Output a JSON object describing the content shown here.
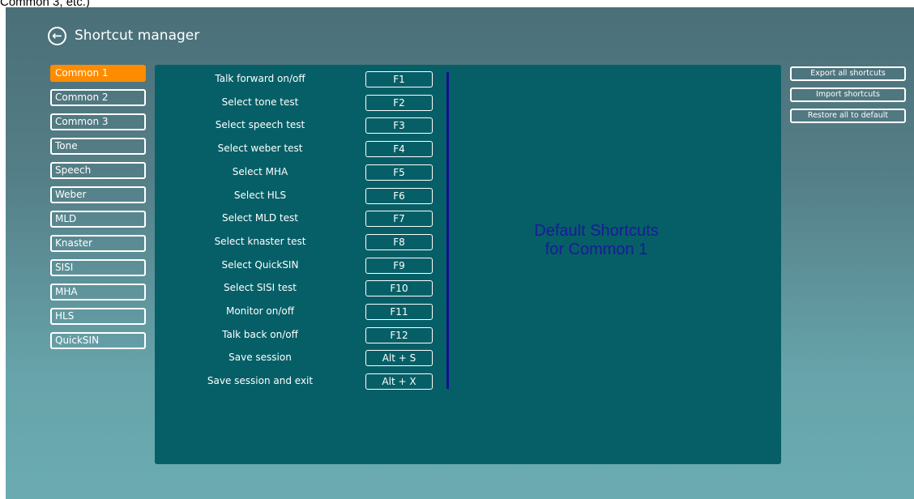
{
  "caption": "Common 3, etc.)",
  "header": {
    "back_icon": "arrow-left-circle-icon",
    "title": "Shortcut manager"
  },
  "tabs": [
    {
      "label": "Common 1",
      "active": true
    },
    {
      "label": "Common 2",
      "active": false
    },
    {
      "label": "Common 3",
      "active": false
    },
    {
      "label": "Tone",
      "active": false
    },
    {
      "label": "Speech",
      "active": false
    },
    {
      "label": "Weber",
      "active": false
    },
    {
      "label": "MLD",
      "active": false
    },
    {
      "label": "Knaster",
      "active": false
    },
    {
      "label": "SISI",
      "active": false
    },
    {
      "label": "MHA",
      "active": false
    },
    {
      "label": "HLS",
      "active": false
    },
    {
      "label": "QuickSIN",
      "active": false
    }
  ],
  "shortcuts": [
    {
      "action": "Talk forward on/off",
      "key": "F1"
    },
    {
      "action": "Select tone test",
      "key": "F2"
    },
    {
      "action": "Select speech test",
      "key": "F3"
    },
    {
      "action": "Select weber test",
      "key": "F4"
    },
    {
      "action": "Select MHA",
      "key": "F5"
    },
    {
      "action": "Select HLS",
      "key": "F6"
    },
    {
      "action": "Select MLD test",
      "key": "F7"
    },
    {
      "action": "Select knaster test",
      "key": "F8"
    },
    {
      "action": "Select QuickSIN",
      "key": "F9"
    },
    {
      "action": "Select SISI test",
      "key": "F10"
    },
    {
      "action": "Monitor on/off",
      "key": "F11"
    },
    {
      "action": "Talk back on/off",
      "key": "F12"
    },
    {
      "action": "Save session",
      "key": "Alt + S"
    },
    {
      "action": "Save session and exit",
      "key": "Alt + X"
    }
  ],
  "panel_note": {
    "line1": "Default Shortcuts",
    "line2": "for Common 1"
  },
  "actions": {
    "export_label": "Export all shortcuts",
    "import_label": "Import shortcuts",
    "restore_label": "Restore all to default"
  },
  "colors": {
    "active_tab": "#ff8c00",
    "panel_bg": "#065f67",
    "divider": "#11118a",
    "note_text": "#1a1a9a"
  }
}
